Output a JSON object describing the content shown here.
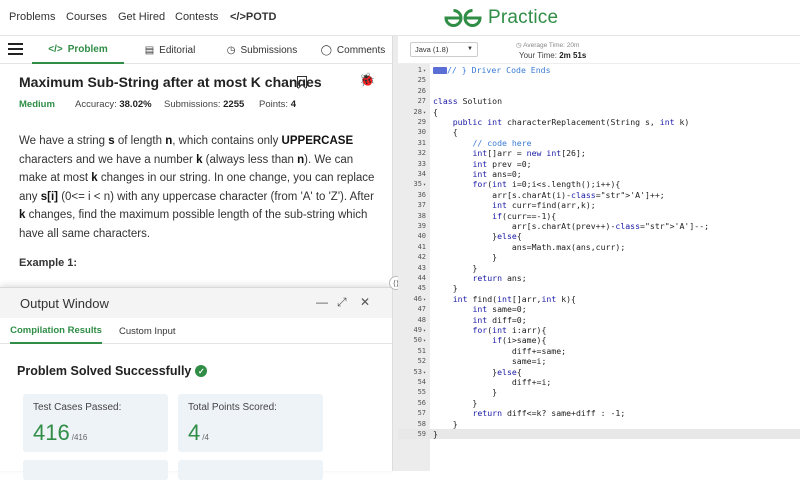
{
  "nav": {
    "items": [
      "Problems",
      "Courses",
      "Get Hired",
      "Contests",
      "POTD"
    ],
    "potd_icon": "code-icon",
    "logo_text": "Practice",
    "brand_color": "#2f8d46"
  },
  "tabs": [
    {
      "label": "Problem",
      "icon": "code-icon"
    },
    {
      "label": "Editorial",
      "icon": "document-icon"
    },
    {
      "label": "Submissions",
      "icon": "clock-icon"
    },
    {
      "label": "Comments",
      "icon": "comment-icon"
    }
  ],
  "problem": {
    "title": "Maximum Sub-String after at most K changes",
    "difficulty": "Medium",
    "accuracy_label": "Accuracy:",
    "accuracy": "38.02%",
    "submissions_label": "Submissions:",
    "submissions": "2255",
    "points_label": "Points:",
    "points": "4",
    "desc": {
      "p1": "We have a string ",
      "s": "s",
      "p2": " of length ",
      "n": "n",
      "p3": ", which contains only ",
      "upper": "UPPERCASE",
      "p4": " characters and we have a number ",
      "k": "k",
      "p5": " (always less than ",
      "n2": "n",
      "p6": "). We can make at most ",
      "k2": "k",
      "p7": " changes in our string. In one change, you can replace any ",
      "si": "s[i]",
      "p8": " (0<= i < n) with any uppercase character (from 'A' to 'Z'). After ",
      "k3": "k",
      "p9": " changes, find the maximum possible length of the sub-string which have all same characters."
    },
    "example_label": "Example 1:"
  },
  "output": {
    "title": "Output Window",
    "tabs": [
      "Compilation Results",
      "Custom Input"
    ],
    "status": "Problem Solved Successfully",
    "tests_label": "Test Cases Passed:",
    "tests_value": "416",
    "tests_total": "/416",
    "points_label": "Total Points Scored:",
    "points_value": "4",
    "points_total": "/4"
  },
  "editor": {
    "language": "Java (1.8)",
    "avg_time_label": "Average Time:",
    "avg_time": "20m",
    "your_time_label": "Your Time:",
    "your_time": "2m 51s",
    "lines": [
      {
        "n": "1",
        "fold": true,
        "text": "// } Driver Code Ends",
        "cls": "cm",
        "collapsed": true
      },
      {
        "n": "25",
        "text": ""
      },
      {
        "n": "26",
        "text": ""
      },
      {
        "n": "27",
        "text": "class Solution"
      },
      {
        "n": "28",
        "fold": true,
        "text": "{"
      },
      {
        "n": "29",
        "text": "    public int characterReplacement(String s, int k)"
      },
      {
        "n": "30",
        "text": "    {"
      },
      {
        "n": "31",
        "text": "        // code here",
        "cls": "cm"
      },
      {
        "n": "32",
        "text": "        int[]arr = new int[26];"
      },
      {
        "n": "33",
        "text": "        int prev =0;"
      },
      {
        "n": "34",
        "text": "        int ans=0;"
      },
      {
        "n": "35",
        "fold": true,
        "text": "        for(int i=0;i<s.length();i++){"
      },
      {
        "n": "36",
        "text": "            arr[s.charAt(i)-'A']++;"
      },
      {
        "n": "37",
        "text": "            int curr=find(arr,k);"
      },
      {
        "n": "38",
        "text": "            if(curr==-1){"
      },
      {
        "n": "39",
        "text": "                arr[s.charAt(prev++)-'A']--;"
      },
      {
        "n": "40",
        "text": "            }else{"
      },
      {
        "n": "41",
        "text": "                ans=Math.max(ans,curr);"
      },
      {
        "n": "42",
        "text": "            }"
      },
      {
        "n": "43",
        "text": "        }"
      },
      {
        "n": "44",
        "text": "        return ans;"
      },
      {
        "n": "45",
        "text": "    }"
      },
      {
        "n": "46",
        "fold": true,
        "text": "    int find(int[]arr,int k){"
      },
      {
        "n": "47",
        "text": "        int same=0;"
      },
      {
        "n": "48",
        "text": "        int diff=0;"
      },
      {
        "n": "49",
        "fold": true,
        "text": "        for(int i:arr){"
      },
      {
        "n": "50",
        "fold": true,
        "text": "            if(i>same){"
      },
      {
        "n": "51",
        "text": "                diff+=same;"
      },
      {
        "n": "52",
        "text": "                same=i;"
      },
      {
        "n": "53",
        "fold": true,
        "text": "            }else{"
      },
      {
        "n": "54",
        "text": "                diff+=i;"
      },
      {
        "n": "55",
        "text": "            }"
      },
      {
        "n": "56",
        "text": "        }"
      },
      {
        "n": "57",
        "text": "        return diff<=k? same+diff : -1;"
      },
      {
        "n": "58",
        "text": "    }"
      },
      {
        "n": "59",
        "text": "}"
      }
    ]
  }
}
